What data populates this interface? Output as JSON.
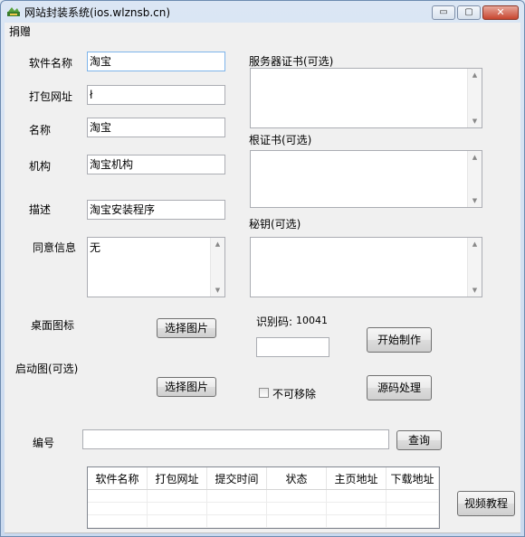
{
  "window": {
    "title": "网站封装系统(ios.wlznsb.cn)",
    "buttons": {
      "minimize": "▭",
      "maximize": "▢",
      "close": "✕"
    }
  },
  "menu": {
    "items": [
      "捐赠"
    ]
  },
  "form": {
    "app_name_label": "软件名称",
    "app_name_value": "淘宝",
    "url_label": "打包网址",
    "url_value": "ł",
    "name_label": "名称",
    "name_value": "淘宝",
    "org_label": "机构",
    "org_value": "淘宝机构",
    "desc_label": "描述",
    "desc_value": "淘宝安装程序",
    "consent_label": "同意信息",
    "consent_value": "无",
    "server_cert_label": "服务器证书(可选)",
    "root_cert_label": "根证书(可选)",
    "key_label": "秘钥(可选)",
    "desktop_icon_label": "桌面图标",
    "select_image_1": "选择图片",
    "splash_label": "启动图(可选)",
    "select_image_2": "选择图片",
    "code_label": "识别码:",
    "code_value": "10041",
    "start_button": "开始制作",
    "non_removable_label": "不可移除",
    "non_removable_checked": false,
    "source_button": "源码处理",
    "number_label": "编号",
    "number_value": "",
    "query_button": "查询",
    "video_button": "视频教程"
  },
  "table": {
    "columns": [
      "软件名称",
      "打包网址",
      "提交时间",
      "状态",
      "主页地址",
      "下载地址"
    ],
    "rows": []
  },
  "colors": {
    "window_frame": "#c9d9ee",
    "client_bg": "#f0f0f0",
    "close_button": "#c7452f"
  }
}
